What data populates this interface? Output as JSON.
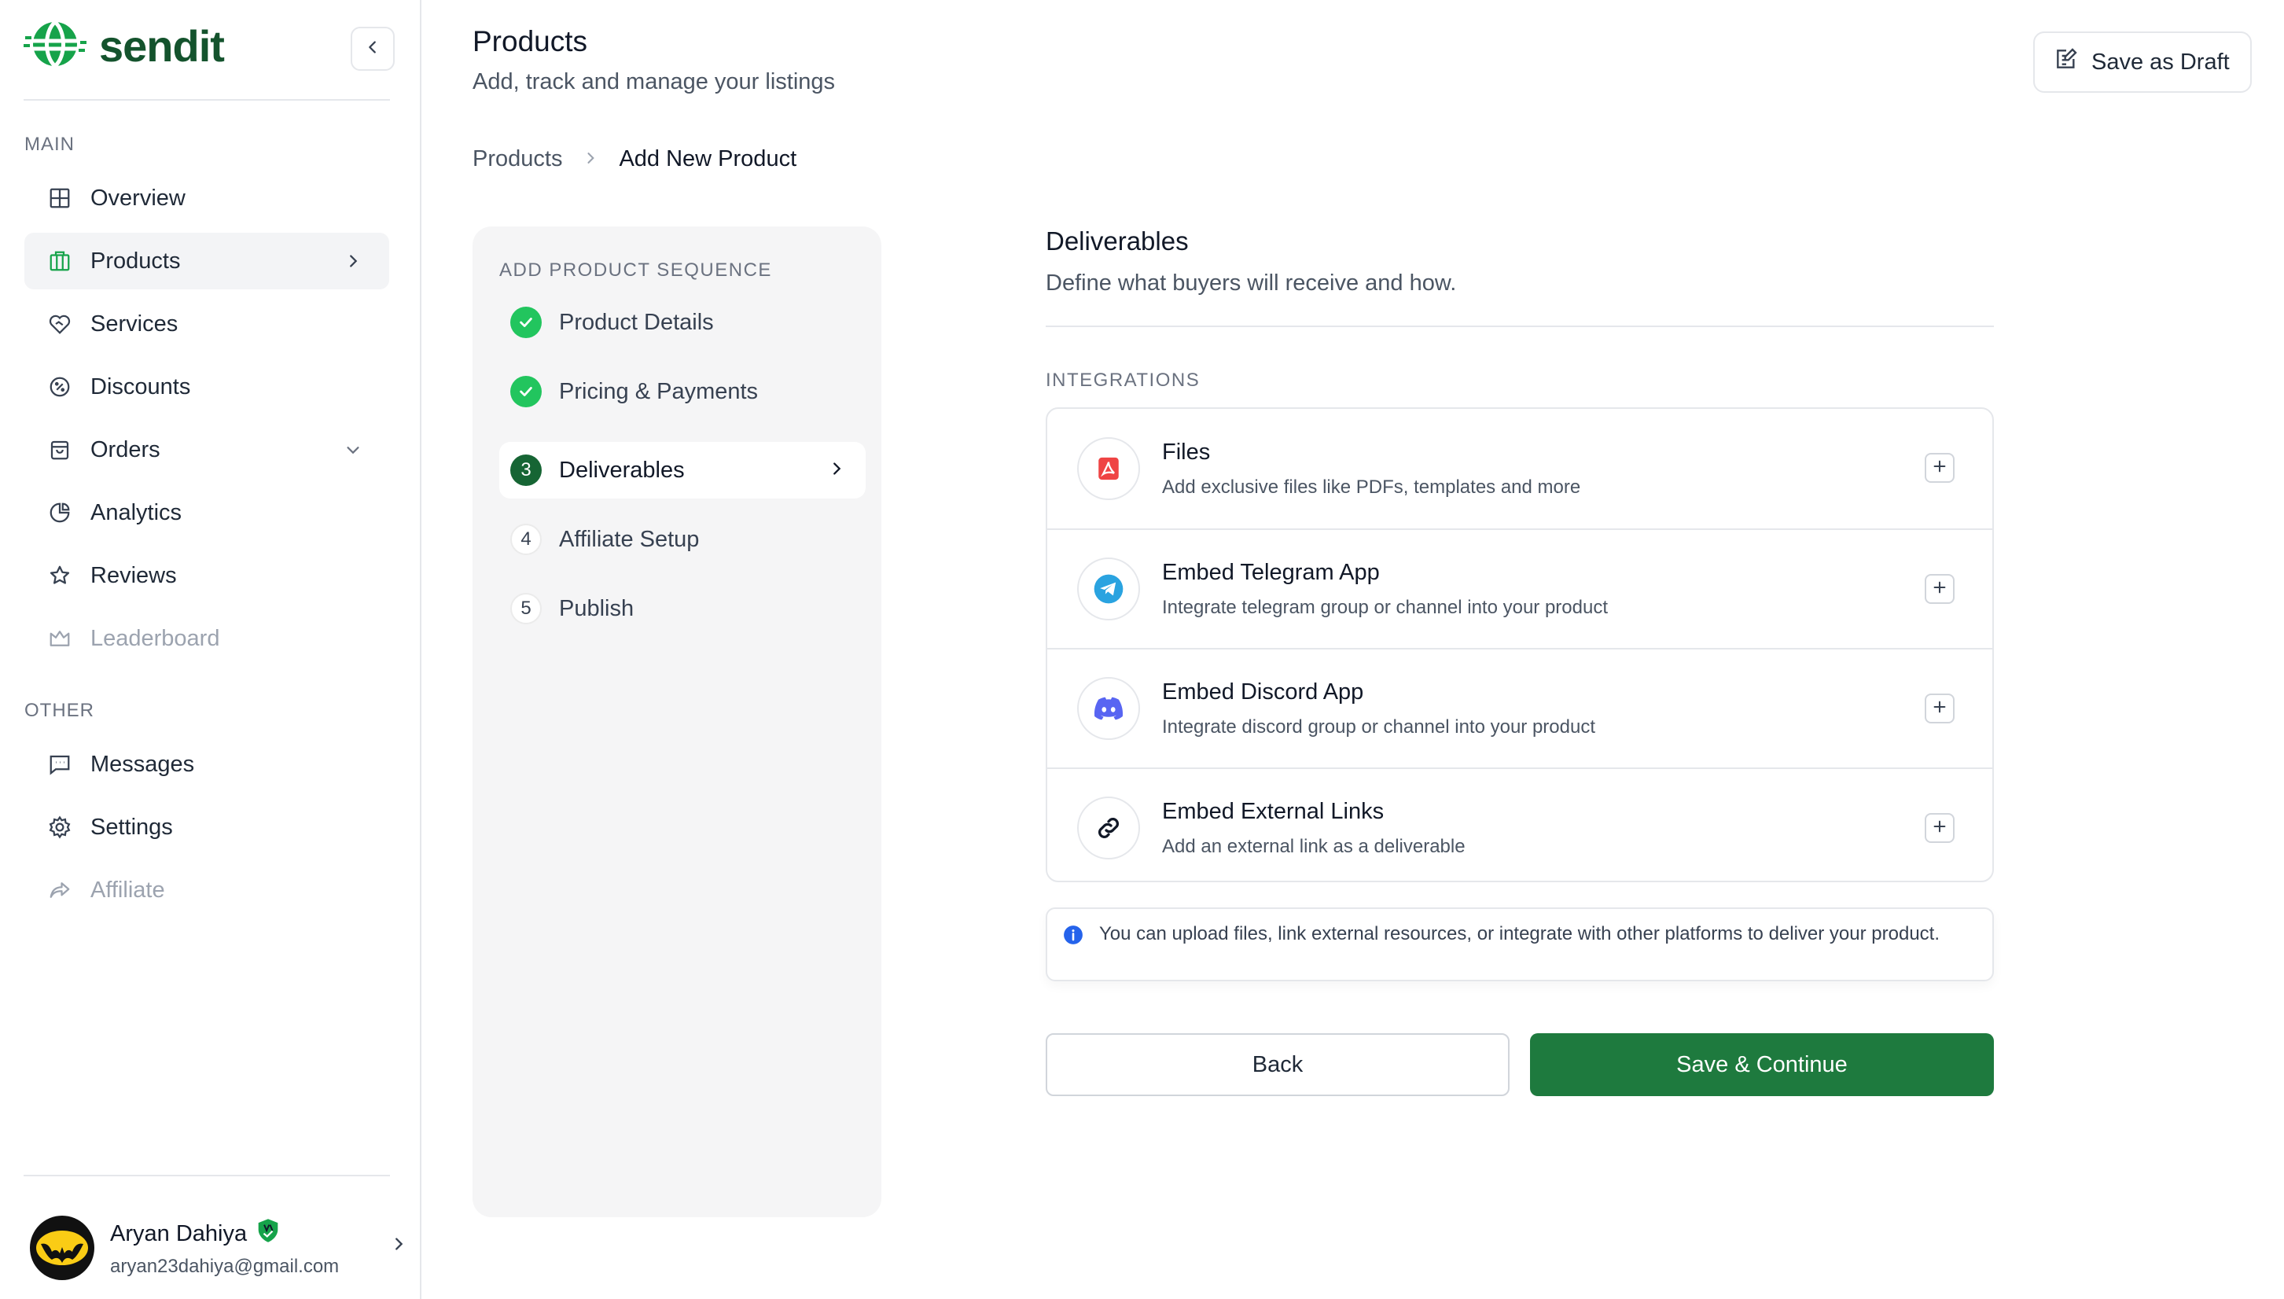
{
  "app": {
    "brand": "sendit",
    "accent_color": "#1e7a3e"
  },
  "sidebar": {
    "main_label": "MAIN",
    "other_label": "OTHER",
    "main_items": [
      {
        "label": "Overview",
        "icon": "grid-icon"
      },
      {
        "label": "Products",
        "icon": "box-icon",
        "active": true
      },
      {
        "label": "Services",
        "icon": "heart-handshake-icon"
      },
      {
        "label": "Discounts",
        "icon": "discount-badge-icon"
      },
      {
        "label": "Orders",
        "icon": "shopping-bag-icon"
      },
      {
        "label": "Analytics",
        "icon": "pie-chart-icon"
      },
      {
        "label": "Reviews",
        "icon": "star-icon"
      },
      {
        "label": "Leaderboard",
        "icon": "crown-icon",
        "disabled": true
      }
    ],
    "other_items": [
      {
        "label": "Messages",
        "icon": "message-icon"
      },
      {
        "label": "Settings",
        "icon": "gear-icon"
      },
      {
        "label": "Affiliate",
        "icon": "share-arrow-icon",
        "disabled": true
      }
    ],
    "user": {
      "name": "Aryan Dahiya",
      "email": "aryan23dahiya@gmail.com"
    }
  },
  "header": {
    "title": "Products",
    "subtitle": "Add, track and manage your listings",
    "save_draft_label": "Save as Draft",
    "breadcrumb": [
      "Products",
      "Add New Product"
    ]
  },
  "sequence": {
    "label": "ADD PRODUCT SEQUENCE",
    "steps": [
      {
        "number": "1",
        "label": "Product Details",
        "state": "done"
      },
      {
        "number": "2",
        "label": "Pricing & Payments",
        "state": "done"
      },
      {
        "number": "3",
        "label": "Deliverables",
        "state": "current"
      },
      {
        "number": "4",
        "label": "Affiliate Setup",
        "state": "todo"
      },
      {
        "number": "5",
        "label": "Publish",
        "state": "todo"
      }
    ]
  },
  "deliverables": {
    "title": "Deliverables",
    "subtitle": "Define what buyers will receive and how.",
    "integrations_label": "INTEGRATIONS",
    "integrations": [
      {
        "title": "Files",
        "description": "Add exclusive files like PDFs, templates and more",
        "icon": "pdf-file-icon"
      },
      {
        "title": "Embed Telegram App",
        "description": "Integrate telegram group or channel into your product",
        "icon": "telegram-icon"
      },
      {
        "title": "Embed Discord App",
        "description": "Integrate discord group or channel into your product",
        "icon": "discord-icon"
      },
      {
        "title": "Embed External Links",
        "description": "Add an external link as a deliverable",
        "icon": "link-icon"
      }
    ],
    "info_text": "You can upload files, link external resources, or integrate with other platforms to deliver your product.",
    "back_label": "Back",
    "save_label": "Save & Continue"
  }
}
